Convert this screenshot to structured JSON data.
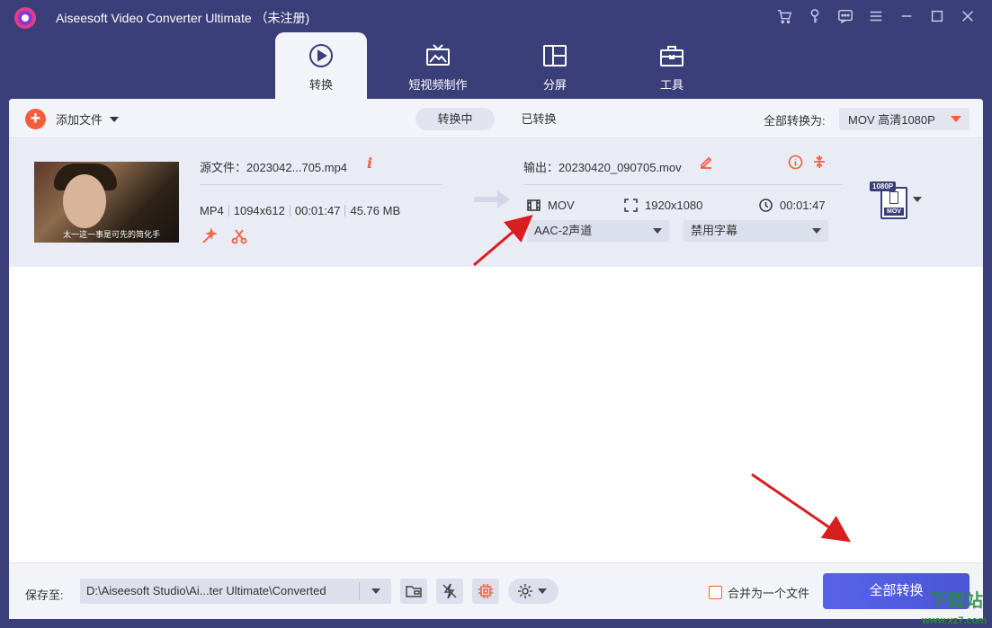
{
  "app": {
    "title": "Aiseesoft Video Converter Ultimate （未注册)"
  },
  "window_icons": [
    "cart-icon",
    "key-icon",
    "feedback-icon",
    "menu-icon",
    "minimize-icon",
    "maximize-icon",
    "close-icon"
  ],
  "tabs": [
    {
      "label": "转换",
      "icon": "convert-icon",
      "active": true
    },
    {
      "label": "短视频制作",
      "icon": "tv-icon",
      "active": false
    },
    {
      "label": "分屏",
      "icon": "split-screen-icon",
      "active": false
    },
    {
      "label": "工具",
      "icon": "toolbox-icon",
      "active": false
    }
  ],
  "toolbar": {
    "add_file_label": "添加文件",
    "seg_converting": "转换中",
    "seg_converted": "已转换",
    "convert_all_to_label": "全部转换为:",
    "format_value": "MOV 高清1080P"
  },
  "file": {
    "thumbnail_subtitle": "太一这一事是可先的简化手",
    "source_label": "源文件：2023042...705.mp4",
    "format": "MP4",
    "resolution": "1094x612",
    "duration": "00:01:47",
    "size": "45.76 MB",
    "output_label": "输出：20230420_090705.mov",
    "out_format": "MOV",
    "out_resolution": "1920x1080",
    "out_duration": "00:01:47",
    "audio_track": "AAC-2声道",
    "subtitle": "禁用字幕",
    "badge_quality": "1080P",
    "badge_format": "MOV"
  },
  "bottom": {
    "save_to_label": "保存至:",
    "path": "D:\\Aiseesoft Studio\\Ai...ter Ultimate\\Converted",
    "merge_label": "合并为一个文件",
    "convert_all_button": "全部转换",
    "watermark": "www.xz7.com",
    "watermark_big": "下载站"
  },
  "colors": {
    "titlebar": "#3a3f7a",
    "accent": "#f45d3c",
    "primary_button": "#4b55d6",
    "annotation_arrow": "#d81e1e"
  }
}
